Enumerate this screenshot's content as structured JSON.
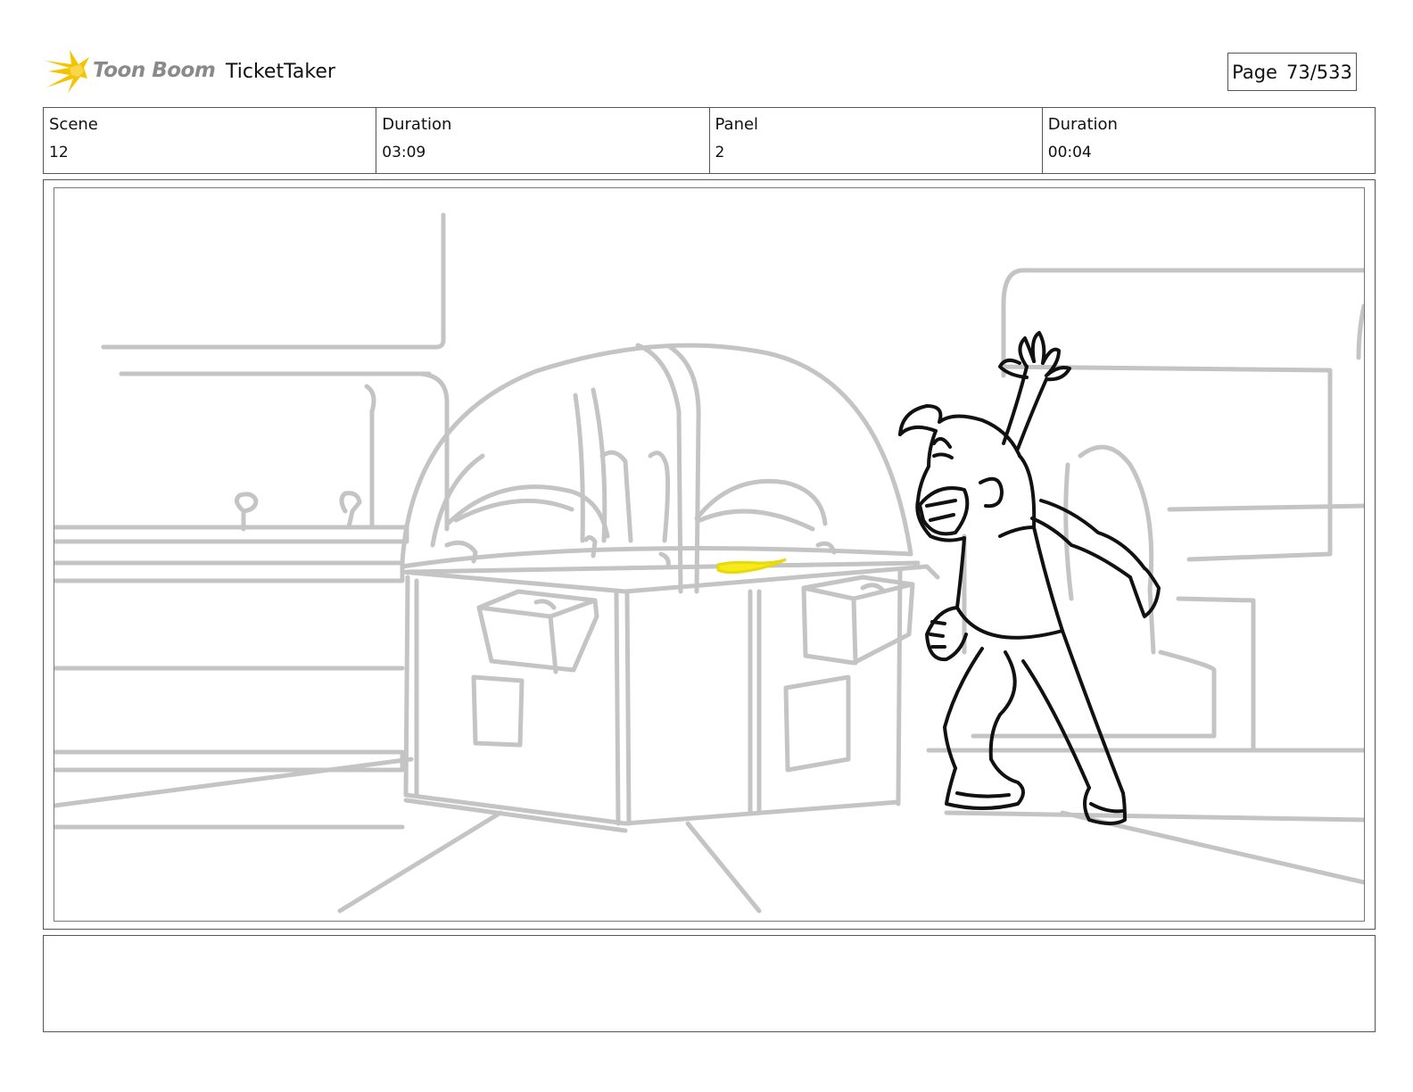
{
  "header": {
    "logo_text": "Toon Boom",
    "project_title": "TicketTaker",
    "page_label": "Page",
    "page_number": "73/533"
  },
  "info": {
    "scene_label": "Scene",
    "scene_value": "12",
    "scene_duration_label": "Duration",
    "scene_duration_value": "03:09",
    "panel_label": "Panel",
    "panel_value": "2",
    "panel_duration_label": "Duration",
    "panel_duration_value": "00:04"
  },
  "colors": {
    "logo_yellow": "#f5c400",
    "sketch_gray": "#c4c4c4",
    "ink_black": "#111111",
    "highlight_yellow": "#f6ea1a"
  },
  "notes": {
    "text": ""
  }
}
